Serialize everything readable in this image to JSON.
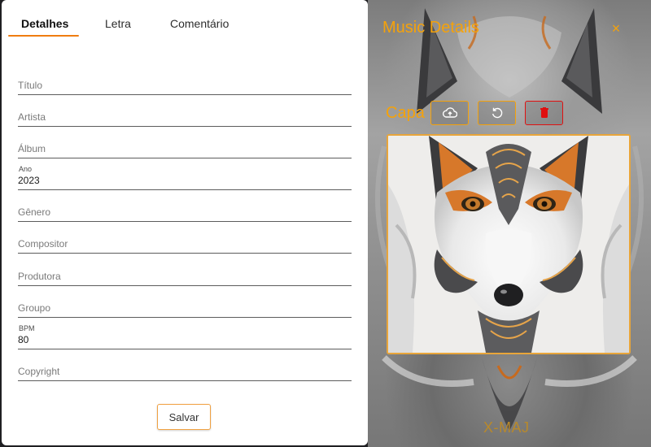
{
  "tabs": [
    {
      "label": "Detalhes",
      "active": true
    },
    {
      "label": "Letra",
      "active": false
    },
    {
      "label": "Comentário",
      "active": false
    }
  ],
  "fields": {
    "titulo": {
      "placeholder": "Título"
    },
    "artista": {
      "placeholder": "Artista"
    },
    "album": {
      "placeholder": "Álbum"
    },
    "ano": {
      "label": "Ano",
      "value": "2023"
    },
    "genero": {
      "placeholder": "Gênero"
    },
    "compositor": {
      "placeholder": "Compositor"
    },
    "produtora": {
      "placeholder": "Produtora"
    },
    "groupo": {
      "placeholder": "Groupo"
    },
    "bpm": {
      "label": "BPM",
      "value": "80"
    },
    "copyright": {
      "placeholder": "Copyright"
    }
  },
  "save_label": "Salvar",
  "panel": {
    "title": "Music Details",
    "close_glyph": "×",
    "cover_label": "Capa",
    "buttons": [
      {
        "icon": "cloud-upload-icon"
      },
      {
        "icon": "reset-icon"
      },
      {
        "icon": "trash-icon"
      }
    ],
    "footer": "X-MAJ"
  },
  "colors": {
    "accent": "#f5a20a",
    "tab_underline": "#f07d10",
    "delete": "#e01010"
  }
}
